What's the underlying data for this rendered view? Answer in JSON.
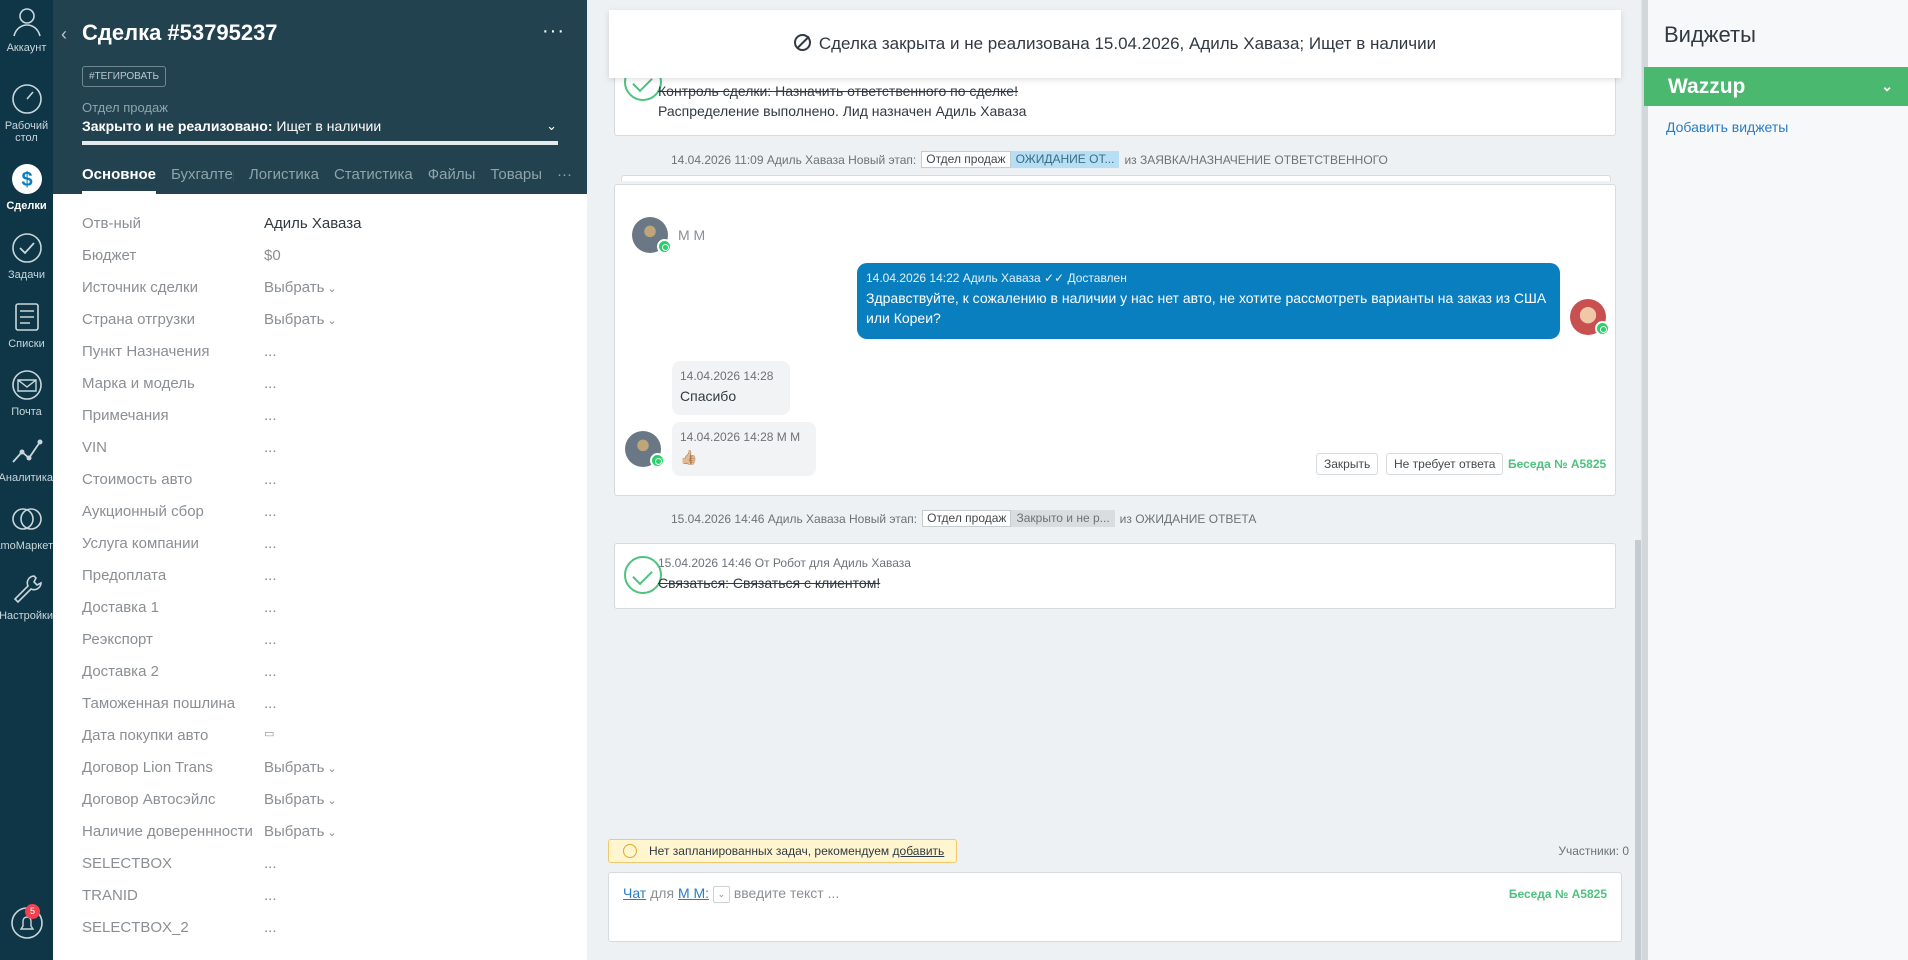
{
  "nav": {
    "items": [
      {
        "label": "Аккаунт",
        "icon": "account-icon"
      },
      {
        "label": "Рабочий стол",
        "icon": "dashboard-icon"
      },
      {
        "label": "Сделки",
        "icon": "deals-icon"
      },
      {
        "label": "Задачи",
        "icon": "tasks-icon"
      },
      {
        "label": "Списки",
        "icon": "lists-icon"
      },
      {
        "label": "Почта",
        "icon": "mail-icon"
      },
      {
        "label": "Аналитика",
        "icon": "analytics-icon"
      },
      {
        "label": "amoМаркет",
        "icon": "market-icon"
      },
      {
        "label": "Настройки",
        "icon": "settings-icon"
      }
    ],
    "notifications_count": "5"
  },
  "card": {
    "title": "Сделка #53795237",
    "tag_button": "#ТЕГИРОВАТЬ",
    "pipeline": "Отдел продаж",
    "status_prefix": "Закрыто и не реализовано:",
    "status_reason": "Ищет в наличии",
    "tabs": [
      "Основное",
      "Бухгалтерия",
      "Логистика",
      "Статистика",
      "Файлы",
      "Товары"
    ],
    "tabs_more": "···",
    "fields": [
      {
        "label": "Отв-ный",
        "value": "Адиль Хаваза"
      },
      {
        "label": "Бюджет",
        "value": "$0"
      },
      {
        "label": "Источник сделки",
        "value": "Выбрать"
      },
      {
        "label": "Страна отгрузки",
        "value": "Выбрать"
      },
      {
        "label": "Пункт Назначения",
        "value": "..."
      },
      {
        "label": "Марка и модель",
        "value": "..."
      },
      {
        "label": "Примечания",
        "value": "..."
      },
      {
        "label": "VIN",
        "value": "..."
      },
      {
        "label": "Стоимость авто",
        "value": "..."
      },
      {
        "label": "Аукционный сбор",
        "value": "..."
      },
      {
        "label": "Услуга компании",
        "value": "..."
      },
      {
        "label": "Предоплата",
        "value": "..."
      },
      {
        "label": "Доставка 1",
        "value": "..."
      },
      {
        "label": "Реэкспорт",
        "value": "..."
      },
      {
        "label": "Доставка 2",
        "value": "..."
      },
      {
        "label": "Таможенная пошлина",
        "value": "..."
      },
      {
        "label": "Дата покупки авто",
        "value": "▭"
      },
      {
        "label": "Договор Lion Trans",
        "value": "Выбрать"
      },
      {
        "label": "Договор Автосэйлс",
        "value": "Выбрать"
      },
      {
        "label": "Наличие довереннности",
        "value": "Выбрать"
      },
      {
        "label": "SELECTBOX",
        "value": "..."
      },
      {
        "label": "TRANID",
        "value": "..."
      },
      {
        "label": "SELECTBOX_2",
        "value": "..."
      }
    ]
  },
  "feed": {
    "closed_banner": "Сделка закрыта и не реализована 15.04.2026, Адиль Хаваза; Ищет в наличии",
    "task1": {
      "line1": "Контроль сделки: Назначить ответственного по сделке!",
      "line2": "Распределение выполнено. Лид назначен Адиль Хаваза"
    },
    "stage1": {
      "meta": "14.04.2026 11:09 Адиль Хаваза Новый этап:",
      "pipeline": "Отдел продаж",
      "stage": "ОЖИДАНИЕ ОТ...",
      "from": "из ЗАЯВКА/НАЗНАЧЕНИЕ ОТВЕТСТВЕННОГО"
    },
    "chat": {
      "contact": "М М",
      "out_meta": "14.04.2026 14:22 Адиль Хаваза",
      "out_status": "Доставлен",
      "out_text_1": "Здравствуйте, к сожалению в наличии у нас нет авто, не хотите рассмотреть варианты на заказ из США",
      "out_text_2": "или Кореи?",
      "in1_meta": "14.04.2026 14:28",
      "in1_text": "Спасибо",
      "in2_meta": "14.04.2026 14:28 М М",
      "in2_text": "👍🏼",
      "close_btn": "Закрыть",
      "no_reply_btn": "Не требует ответа",
      "conversation": "Беседа № A5825"
    },
    "stage2": {
      "meta": "15.04.2026 14:46 Адиль Хаваза Новый этап:",
      "pipeline": "Отдел продаж",
      "stage": "Закрыто и не р...",
      "from": "из ОЖИДАНИЕ ОТВЕТА"
    },
    "task2": {
      "meta": "15.04.2026 14:46  От Робот для Адиль Хаваза",
      "text": "Связаться: Связаться с клиентом!"
    },
    "tasks_warning_text": "Нет запланированных задач, рекомендуем",
    "tasks_warning_link": "добавить",
    "participants": "Участники: 0",
    "composer": {
      "chat_link": "Чат",
      "for": "для",
      "contact_link": "М М:",
      "placeholder": "введите текст ...",
      "conversation": "Беседа № A5825"
    }
  },
  "widgets": {
    "title": "Виджеты",
    "wazzup": "Wazzup",
    "add_link": "Добавить виджеты"
  },
  "colors": {
    "nav_bg": "#0e3647",
    "card_head_bg": "#23424f",
    "feed_bg": "#edf1f4",
    "accent_blue": "#0a7fbf",
    "accent_green": "#4ab86f"
  }
}
